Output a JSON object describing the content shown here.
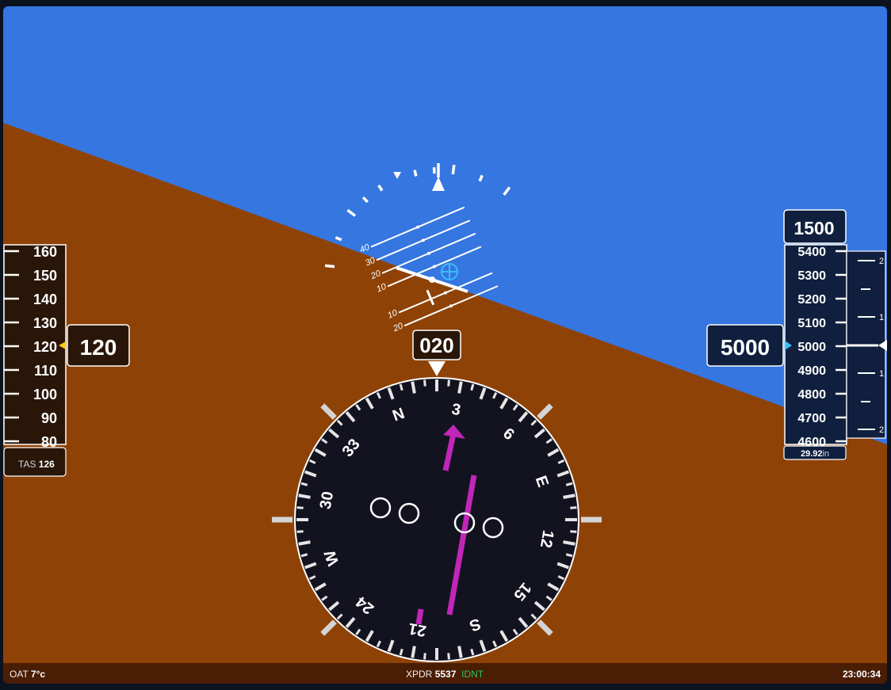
{
  "attitude": {
    "pitch_deg": 0,
    "roll_deg": -23
  },
  "airspeed": {
    "current": "120",
    "tape_labels": [
      "160",
      "150",
      "140",
      "130",
      "120",
      "110",
      "100",
      "90",
      "80"
    ],
    "tas_label": "TAS",
    "tas_value": "126"
  },
  "altitude": {
    "current": "5000",
    "selected": "1500",
    "tape_labels": [
      "5400",
      "5300",
      "5200",
      "5100",
      "5000",
      "4900",
      "4800",
      "4700",
      "4600"
    ],
    "baro_value": "29.92",
    "baro_unit": "in"
  },
  "vsi": {
    "labels": [
      "2",
      "1",
      "1",
      "2"
    ],
    "value_fpm": 0
  },
  "heading": {
    "current": "020",
    "value_deg": 20,
    "compass_labels": [
      "N",
      "3",
      "6",
      "E",
      "12",
      "15",
      "S",
      "21",
      "24",
      "W",
      "30",
      "33"
    ],
    "course_deg": 15
  },
  "pitch_ladder": {
    "labels": [
      "40",
      "30",
      "20",
      "10",
      "10",
      "20"
    ]
  },
  "status": {
    "oat_label": "OAT",
    "oat_value": "7°c",
    "xpdr_label": "XPDR",
    "xpdr_code": "5537",
    "xpdr_mode": "IDNT",
    "time": "23:00:34"
  },
  "colors": {
    "sky": "#3576e0",
    "ground": "#8f4206",
    "panel": "#2a1608",
    "alt_panel": "#0f1f3d",
    "course": "#c026b8",
    "fpv": "#38bdf8",
    "bug": "#facc15",
    "xpdr_mode": "#22c55e"
  }
}
